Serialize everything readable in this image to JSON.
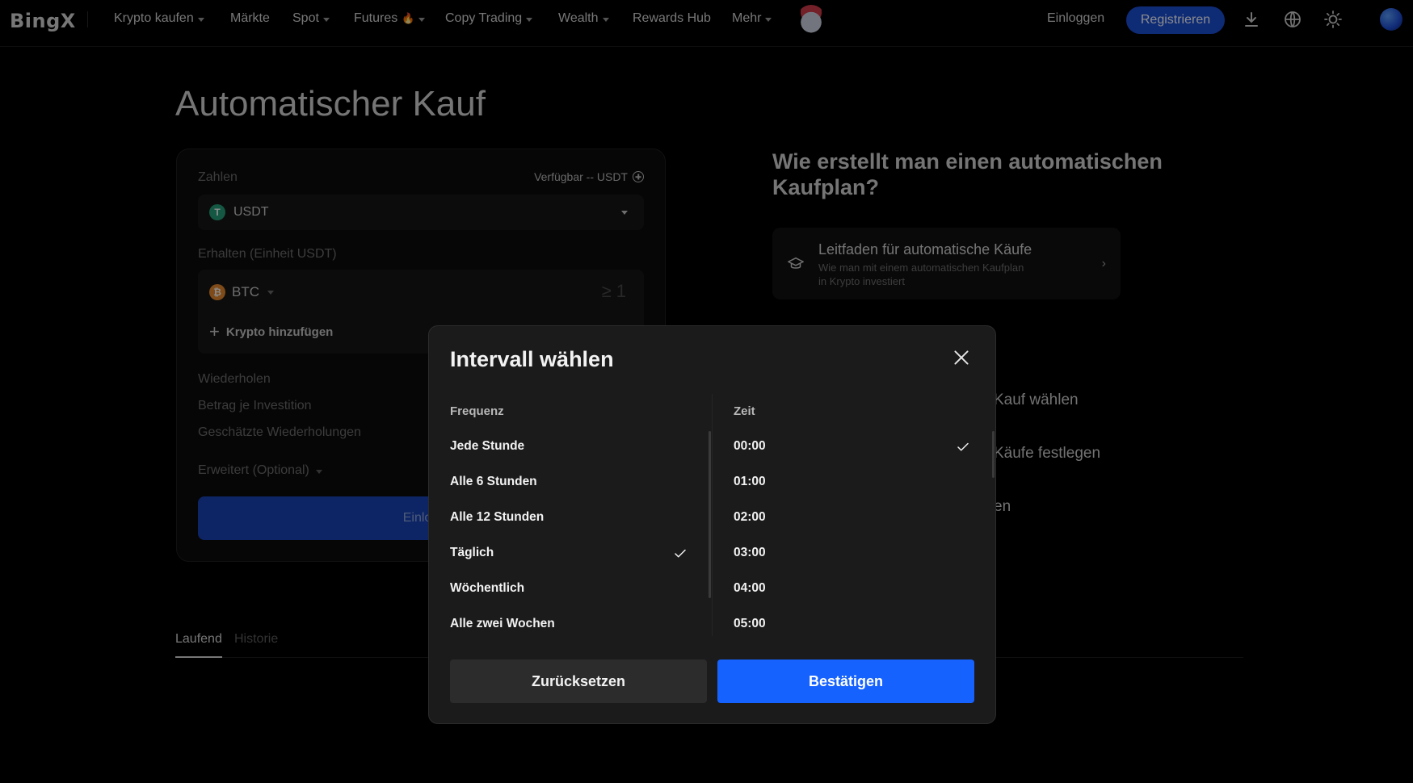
{
  "nav": {
    "logo": "BingX",
    "items": [
      {
        "label": "Krypto kaufen",
        "dropdown": true
      },
      {
        "label": "Märkte",
        "dropdown": false
      },
      {
        "label": "Spot",
        "dropdown": true
      },
      {
        "label": "Futures",
        "dropdown": true,
        "badge_icon": "fire-icon"
      },
      {
        "label": "Copy Trading",
        "dropdown": true
      },
      {
        "label": "Wealth",
        "dropdown": true
      },
      {
        "label": "Rewards Hub",
        "dropdown": false
      },
      {
        "label": "Mehr",
        "dropdown": true
      }
    ],
    "login": "Einloggen",
    "register": "Registrieren",
    "icons": [
      "download-icon",
      "globe-icon",
      "theme-sun-icon"
    ]
  },
  "page": {
    "title": "Automatischer Kauf"
  },
  "form": {
    "pay_label": "Zahlen",
    "available": "Verfügbar -- USDT",
    "pay_currency": "USDT",
    "receive_label": "Erhalten (Einheit USDT)",
    "receive_coin": "BTC",
    "receive_amount": "≥ 1",
    "add_crypto": "Krypto hinzufügen",
    "repeat_label": "Wiederholen",
    "amount_per_investment_label": "Betrag je Investition",
    "estimated_repeats_label": "Geschätzte Wiederholungen",
    "advanced_label": "Erweitert (Optional)",
    "cta_partial": "Einlog"
  },
  "tabs": [
    {
      "label": "Laufend",
      "active": true
    },
    {
      "label": "Historie",
      "active": false
    }
  ],
  "howto": {
    "title": "Wie erstellt man einen automatischen Kaufplan?",
    "guide_title": "Leitfaden für automatische Käufe",
    "guide_subtitle": "Wie man mit einem automatischen Kaufplan in Krypto investiert",
    "steps_partial": [
      "Kauf wählen",
      "Käufe festlegen",
      "en"
    ]
  },
  "modal": {
    "title": "Intervall wählen",
    "frequency_header": "Frequenz",
    "time_header": "Zeit",
    "frequencies": [
      {
        "label": "Jede Stunde",
        "selected": false
      },
      {
        "label": "Alle 6 Stunden",
        "selected": false
      },
      {
        "label": "Alle 12 Stunden",
        "selected": false
      },
      {
        "label": "Täglich",
        "selected": true
      },
      {
        "label": "Wöchentlich",
        "selected": false
      },
      {
        "label": "Alle zwei Wochen",
        "selected": false
      }
    ],
    "times": [
      {
        "label": "00:00",
        "selected": true
      },
      {
        "label": "01:00",
        "selected": false
      },
      {
        "label": "02:00",
        "selected": false
      },
      {
        "label": "03:00",
        "selected": false
      },
      {
        "label": "04:00",
        "selected": false
      },
      {
        "label": "05:00",
        "selected": false
      }
    ],
    "reset": "Zurücksetzen",
    "confirm": "Bestätigen"
  },
  "colors": {
    "accent": "#1662ff",
    "register_button": "#1b4fd8",
    "modal_bg": "#1b1b1b"
  }
}
